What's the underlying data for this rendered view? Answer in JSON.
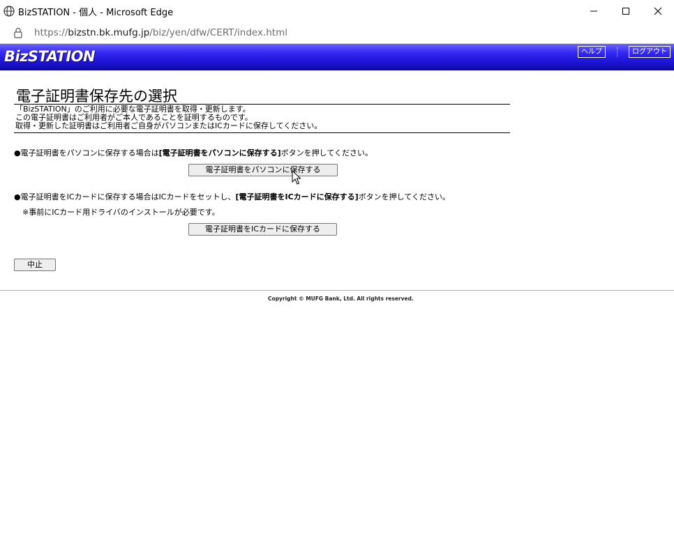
{
  "window": {
    "title": "BizSTATION - 個人 - Microsoft Edge"
  },
  "address_bar": {
    "url_prefix": "https://",
    "url_host": "bizstn.bk.mufg.jp",
    "url_path": "/biz/yen/dfw/CERT/index.html"
  },
  "header": {
    "logo": "BizSTATION",
    "help_label": "ヘルプ",
    "logout_label": "ログアウト",
    "background_color": "#2a1ee8"
  },
  "main": {
    "page_title": "電子証明書保存先の選択",
    "intro_lines": [
      "「BizSTATION」のご利用に必要な電子証明書を取得・更新します。",
      "この電子証明書はご利用者がご本人であることを証明するものです。",
      "取得・更新した証明書はご利用者ご自身がパソコンまたはICカードに保存してください。"
    ],
    "pc_instruction": {
      "prefix": "●電子証明書をパソコンに保存する場合は",
      "bold": "[電子証明書をパソコンに保存する]",
      "suffix": "ボタンを押してください。"
    },
    "pc_button_label": "電子証明書をパソコンに保存する",
    "ic_instruction": {
      "prefix": "●電子証明書をICカードに保存する場合はICカードをセットし、",
      "bold": "[電子証明書をICカードに保存する]",
      "suffix": "ボタンを押してください。"
    },
    "ic_note": "※事前にICカード用ドライバのインストールが必要です。",
    "ic_button_label": "電子証明書をICカードに保存する",
    "cancel_button_label": "中止"
  },
  "footer": {
    "copyright": "Copyright © MUFG Bank, Ltd. All rights reserved."
  }
}
